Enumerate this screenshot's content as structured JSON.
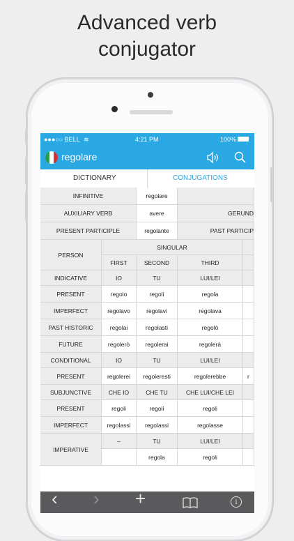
{
  "promo": {
    "line1": "Advanced verb",
    "line2": "conjugator"
  },
  "status_bar": {
    "carrier": "●●●○○ BELL",
    "wifi": "≋",
    "time": "4:21 PM",
    "battery": "100%"
  },
  "nav": {
    "title": "regolare",
    "flag": "italy-flag",
    "icons": [
      "speaker-icon",
      "search-icon"
    ]
  },
  "tabs": {
    "dictionary": "DICTIONARY",
    "conjugations": "CONJUGATIONS",
    "active": "CONJUGATIONS"
  },
  "info_rows": {
    "infinitive_label": "INFINITIVE",
    "infinitive_value": "regolare",
    "auxiliary_label": "AUXILIARY VERB",
    "auxiliary_value": "avere",
    "gerund_label": "GERUND",
    "present_participle_label": "PRESENT PARTICIPLE",
    "present_participle_value": "regolante",
    "past_participle_label": "PAST PARTICIP"
  },
  "table": {
    "person_label": "PERSON",
    "singular_label": "SINGULAR",
    "columns": [
      "FIRST",
      "SECOND",
      "THIRD"
    ],
    "sections": [
      {
        "title": "INDICATIVE",
        "pronouns": [
          "IO",
          "TU",
          "LUI/LEI"
        ],
        "rows": [
          {
            "tense": "PRESENT",
            "forms": [
              "regolo",
              "regoli",
              "regola"
            ]
          },
          {
            "tense": "IMPERFECT",
            "forms": [
              "regolavo",
              "regolavi",
              "regolava"
            ]
          },
          {
            "tense": "PAST HISTORIC",
            "forms": [
              "regolai",
              "regolasti",
              "regolò"
            ]
          },
          {
            "tense": "FUTURE",
            "forms": [
              "regolerò",
              "regolerai",
              "regolerà"
            ]
          }
        ]
      },
      {
        "title": "CONDITIONAL",
        "pronouns": [
          "IO",
          "TU",
          "LUI/LEI"
        ],
        "rows": [
          {
            "tense": "PRESENT",
            "forms": [
              "regolerei",
              "regoleresti",
              "regolerebbe"
            ]
          }
        ]
      },
      {
        "title": "SUBJUNCTIVE",
        "pronouns": [
          "CHE IO",
          "CHE TU",
          "CHE LUI/CHE LEI"
        ],
        "rows": [
          {
            "tense": "PRESENT",
            "forms": [
              "regoli",
              "regoli",
              "regoli"
            ]
          },
          {
            "tense": "IMPERFECT",
            "forms": [
              "regolassi",
              "regolassi",
              "regolasse"
            ]
          }
        ]
      }
    ],
    "imperative": {
      "title": "IMPERATIVE",
      "pronouns": [
        "–",
        "TU",
        "LUI/LEI"
      ],
      "forms": [
        "",
        "regola",
        "regoli"
      ]
    },
    "overflow_cut": "r"
  },
  "toolbar": {
    "back": "‹",
    "forward": "›",
    "add": "+",
    "bookmarks": "bookmarks-icon",
    "info": "i"
  },
  "colors": {
    "accent": "#2aa8e4",
    "header_cell": "#ececec",
    "toolbar": "#5a5a5c"
  }
}
